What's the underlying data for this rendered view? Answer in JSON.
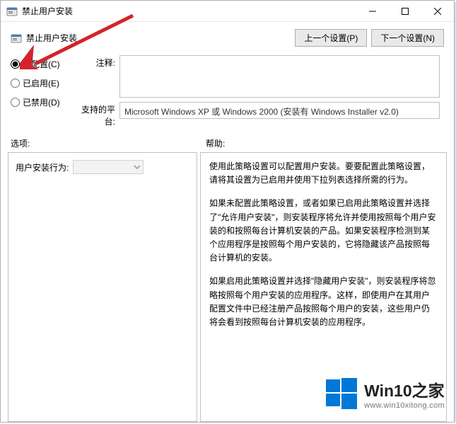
{
  "window": {
    "title": "禁止用户安装"
  },
  "subheader": {
    "title": "禁止用户安装"
  },
  "nav": {
    "prev_label": "上一个设置(P)",
    "next_label": "下一个设置(N)"
  },
  "radios": {
    "not_configured": "未配置(C)",
    "enabled": "已启用(E)",
    "disabled": "已禁用(D)"
  },
  "labels": {
    "comment": "注释:",
    "platform": "支持的平台:",
    "options": "选项:",
    "help": "帮助:",
    "user_install_behavior": "用户安装行为:"
  },
  "fields": {
    "comment_value": "",
    "platform_value": "Microsoft Windows XP 或 Windows 2000 (安装有 Windows Installer v2.0)"
  },
  "help": {
    "p1": "使用此策略设置可以配置用户安装。要要配置此策略设置，请将其设置为已启用并使用下拉列表选择所需的行为。",
    "p2": "如果未配置此策略设置，或者如果已启用此策略设置并选择了\"允许用户安装\"，则安装程序将允许并使用按照每个用户安装的和按照每台计算机安装的产品。如果安装程序检测到某个应用程序是按照每个用户安装的，它将隐藏该产品按照每台计算机的安装。",
    "p3": "如果启用此策略设置并选择\"隐藏用户安装\"，则安装程序将忽略按照每个用户安装的应用程序。这样，即使用户在其用户配置文件中已经注册产品按照每个用户的安装，这些用户仍将会看到按照每台计算机安装的应用程序。"
  },
  "watermark": {
    "title": "Win10之家",
    "url": "www.win10xitong.com"
  }
}
